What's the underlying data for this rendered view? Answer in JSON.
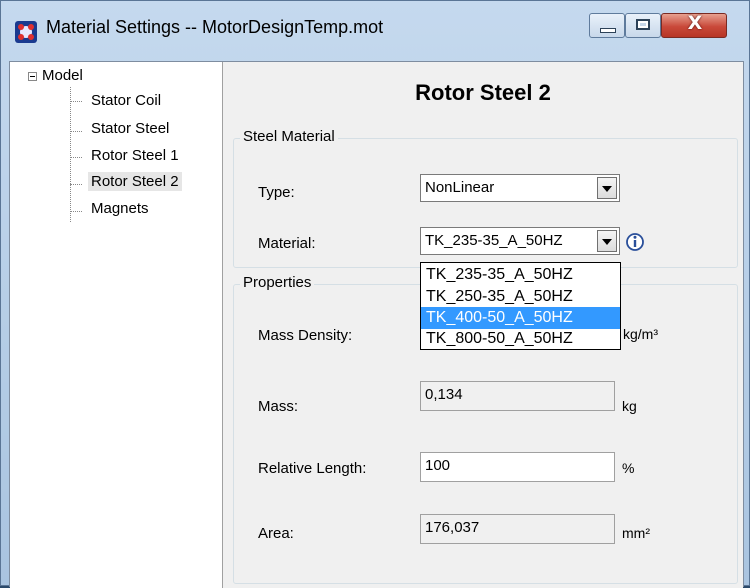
{
  "window": {
    "title": "Material Settings -- MotorDesignTemp.mot",
    "close_symbol": "X",
    "icons": [
      "app-icon",
      "minimize-icon",
      "maximize-icon",
      "close-icon"
    ]
  },
  "tree": {
    "root": "Model",
    "items": [
      {
        "label": "Stator Coil"
      },
      {
        "label": "Stator Steel"
      },
      {
        "label": "Rotor Steel 1"
      },
      {
        "label": "Rotor Steel 2",
        "selected": true
      },
      {
        "label": "Magnets"
      }
    ]
  },
  "panel": {
    "heading": "Rotor Steel 2",
    "steel_material": {
      "group_label": "Steel Material",
      "type_label": "Type:",
      "type_value": "NonLinear",
      "material_label": "Material:",
      "material_value": "TK_235-35_A_50HZ",
      "material_options": [
        "TK_235-35_A_50HZ",
        "TK_250-35_A_50HZ",
        "TK_400-50_A_50HZ",
        "TK_800-50_A_50HZ"
      ],
      "highlighted_option": "TK_400-50_A_50HZ"
    },
    "properties": {
      "group_label": "Properties",
      "mass_density_label": "Mass Density:",
      "mass_density_unit": "kg/m³",
      "mass_label": "Mass:",
      "mass_value": "0,134",
      "mass_unit": "kg",
      "relative_length_label": "Relative Length:",
      "relative_length_value": "100",
      "relative_length_unit": "%",
      "area_label": "Area:",
      "area_value": "176,037",
      "area_unit": "mm²"
    }
  },
  "colors": {
    "selection_highlight": "#3399ff",
    "close_button": "#c9493a",
    "tree_selected_bg": "#e6e6e6"
  }
}
